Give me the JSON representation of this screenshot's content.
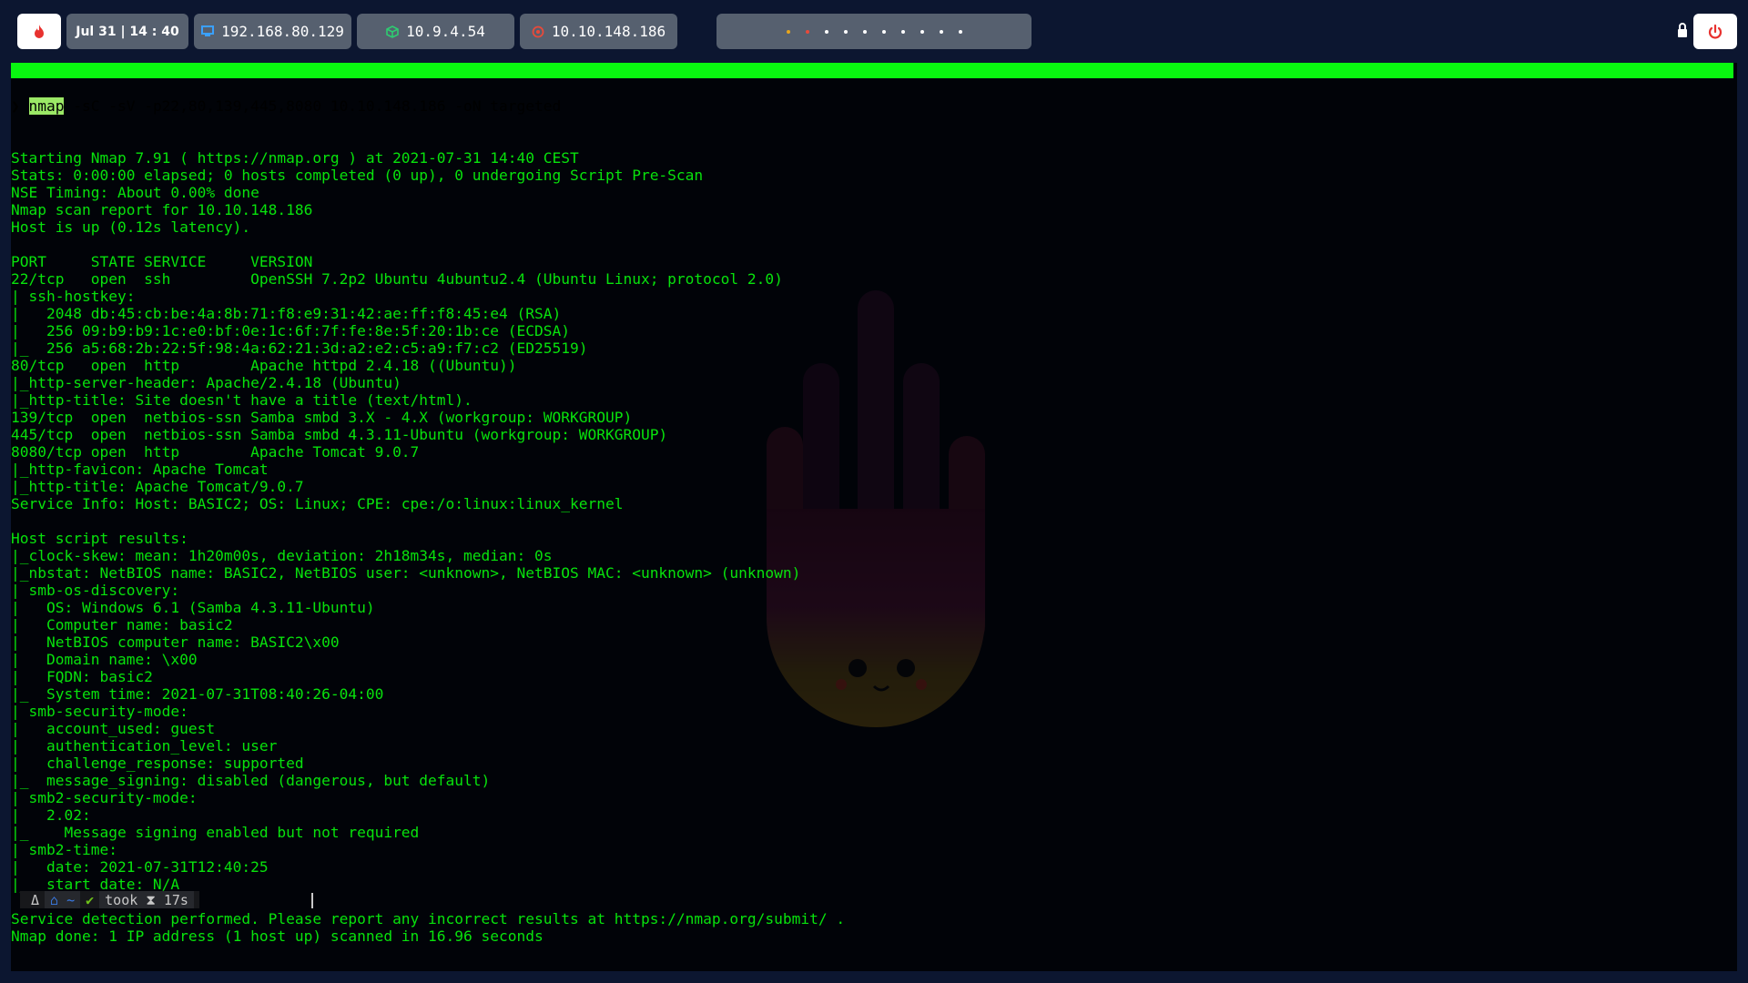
{
  "topbar": {
    "datetime": "Jul 31  |  14 : 40",
    "ip_local": "192.168.80.129",
    "ip_vpn": "10.9.4.54",
    "ip_target": "10.10.148.186",
    "dot_colors": [
      "#e8a51c",
      "#e84a3a",
      "#ffffff",
      "#ffffff",
      "#ffffff",
      "#ffffff",
      "#ffffff",
      "#ffffff",
      "#ffffff",
      "#ffffff"
    ],
    "colors": {
      "bar_bg": "#0c1630",
      "box_bg": "#56606f",
      "fire": "#e8322f",
      "power": "#e8322f",
      "vpn": "#2ecc71",
      "target": "#e84a3a",
      "monitor": "#3aa0ff"
    }
  },
  "terminal": {
    "prompt_symbol": "❯",
    "command_name": "nmap",
    "command_args": " -sC -sV -p22,80,139,445,8080 10.10.148.186 -oN targeted",
    "output": [
      "Starting Nmap 7.91 ( https://nmap.org ) at 2021-07-31 14:40 CEST",
      "Stats: 0:00:00 elapsed; 0 hosts completed (0 up), 0 undergoing Script Pre-Scan",
      "NSE Timing: About 0.00% done",
      "Nmap scan report for 10.10.148.186",
      "Host is up (0.12s latency).",
      "",
      "PORT     STATE SERVICE     VERSION",
      "22/tcp   open  ssh         OpenSSH 7.2p2 Ubuntu 4ubuntu2.4 (Ubuntu Linux; protocol 2.0)",
      "| ssh-hostkey:",
      "|   2048 db:45:cb:be:4a:8b:71:f8:e9:31:42:ae:ff:f8:45:e4 (RSA)",
      "|   256 09:b9:b9:1c:e0:bf:0e:1c:6f:7f:fe:8e:5f:20:1b:ce (ECDSA)",
      "|_  256 a5:68:2b:22:5f:98:4a:62:21:3d:a2:e2:c5:a9:f7:c2 (ED25519)",
      "80/tcp   open  http        Apache httpd 2.4.18 ((Ubuntu))",
      "|_http-server-header: Apache/2.4.18 (Ubuntu)",
      "|_http-title: Site doesn't have a title (text/html).",
      "139/tcp  open  netbios-ssn Samba smbd 3.X - 4.X (workgroup: WORKGROUP)",
      "445/tcp  open  netbios-ssn Samba smbd 4.3.11-Ubuntu (workgroup: WORKGROUP)",
      "8080/tcp open  http        Apache Tomcat 9.0.7",
      "|_http-favicon: Apache Tomcat",
      "|_http-title: Apache Tomcat/9.0.7",
      "Service Info: Host: BASIC2; OS: Linux; CPE: cpe:/o:linux:linux_kernel",
      "",
      "Host script results:",
      "|_clock-skew: mean: 1h20m00s, deviation: 2h18m34s, median: 0s",
      "|_nbstat: NetBIOS name: BASIC2, NetBIOS user: <unknown>, NetBIOS MAC: <unknown> (unknown)",
      "| smb-os-discovery:",
      "|   OS: Windows 6.1 (Samba 4.3.11-Ubuntu)",
      "|   Computer name: basic2",
      "|   NetBIOS computer name: BASIC2\\x00",
      "|   Domain name: \\x00",
      "|   FQDN: basic2",
      "|_  System time: 2021-07-31T08:40:26-04:00",
      "| smb-security-mode:",
      "|   account_used: guest",
      "|   authentication_level: user",
      "|   challenge_response: supported",
      "|_  message_signing: disabled (dangerous, but default)",
      "| smb2-security-mode:",
      "|   2.02:",
      "|_    Message signing enabled but not required",
      "| smb2-time:",
      "|   date: 2021-07-31T12:40:25",
      "|_  start_date: N/A",
      "",
      "Service detection performed. Please report any incorrect results at https://nmap.org/submit/ .",
      "Nmap done: 1 IP address (1 host up) scanned in 16.96 seconds"
    ],
    "prompt_bar": {
      "user_icon": "Δ",
      "home_icon": "⌂",
      "dir": "~",
      "status_icon": "✔",
      "took_label": "took",
      "hourglass": "⧗",
      "duration": "17s"
    },
    "text_color": "#08e20c",
    "cmd_bar_color": "#09f710"
  }
}
